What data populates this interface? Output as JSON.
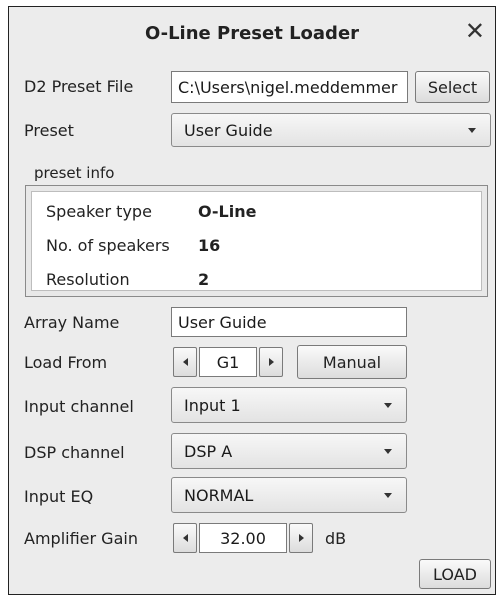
{
  "window": {
    "title": "O-Line Preset Loader",
    "close_glyph": "✕"
  },
  "d2_preset_file": {
    "label": "D2 Preset File",
    "value": "C:\\Users\\nigel.meddemmer",
    "select_button": "Select"
  },
  "preset": {
    "label": "Preset",
    "value": "User Guide"
  },
  "preset_info": {
    "group_label": "preset info",
    "speaker_type": {
      "label": "Speaker type",
      "value": "O-Line"
    },
    "num_speakers": {
      "label": "No. of speakers",
      "value": "16"
    },
    "resolution": {
      "label": "Resolution",
      "value": "2"
    }
  },
  "array_name": {
    "label": "Array Name",
    "value": "User Guide"
  },
  "load_from": {
    "label": "Load From",
    "value": "G1",
    "manual_button": "Manual"
  },
  "input_channel": {
    "label": "Input channel",
    "value": "Input 1"
  },
  "dsp_channel": {
    "label": "DSP channel",
    "value": "DSP A"
  },
  "input_eq": {
    "label": "Input EQ",
    "value": "NORMAL"
  },
  "amplifier_gain": {
    "label": "Amplifier Gain",
    "value": "32.00",
    "unit": "dB"
  },
  "load_button": "LOAD",
  "icons": {
    "close": "close-icon",
    "dropdown": "chevron-down-icon",
    "decrement": "arrow-left-icon",
    "increment": "arrow-right-icon"
  }
}
